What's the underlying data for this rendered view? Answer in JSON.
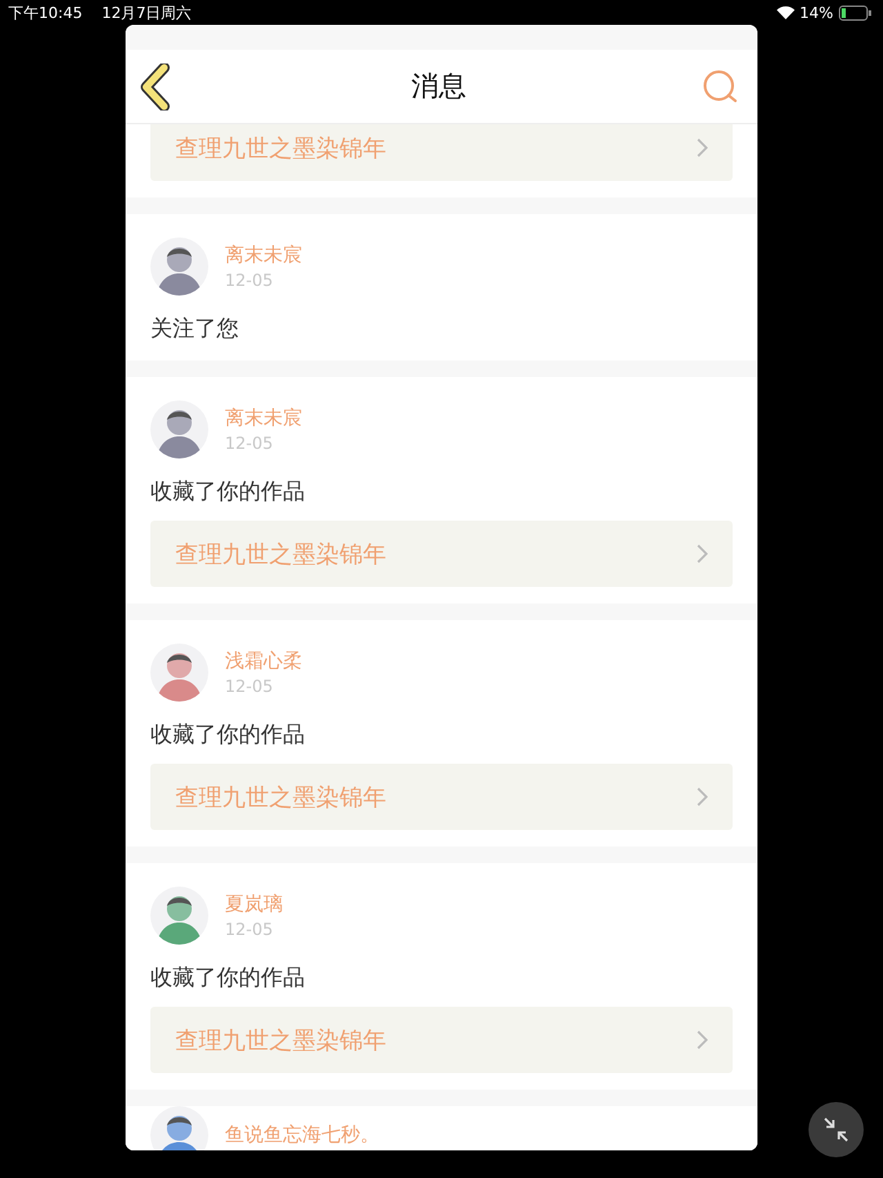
{
  "status_bar": {
    "time": "下午10:45",
    "date": "12月7日周六",
    "battery": "14%"
  },
  "header": {
    "title": "消息"
  },
  "messages": [
    {
      "kind": "link_only",
      "link": "查理九世之墨染锦年"
    },
    {
      "kind": "follow",
      "name": "离末未宸",
      "date": "12-05",
      "action": "关注了您"
    },
    {
      "kind": "work",
      "name": "离末未宸",
      "date": "12-05",
      "action": "收藏了你的作品",
      "link": "查理九世之墨染锦年"
    },
    {
      "kind": "work",
      "name": "浅霜心柔",
      "date": "12-05",
      "action": "收藏了你的作品",
      "link": "查理九世之墨染锦年"
    },
    {
      "kind": "work",
      "name": "夏岚璃",
      "date": "12-05",
      "action": "收藏了你的作品",
      "link": "查理九世之墨染锦年"
    },
    {
      "kind": "cut",
      "name": "鱼说鱼忘海七秒。"
    }
  ]
}
